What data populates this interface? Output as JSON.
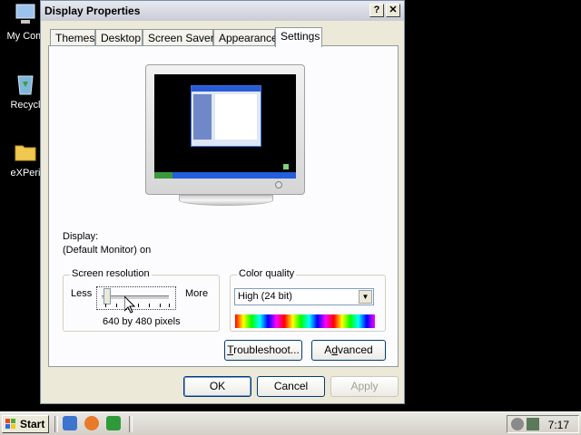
{
  "desktop": {
    "icons": [
      {
        "label": "My Com",
        "icon": "computer-icon"
      },
      {
        "label": "Recycl",
        "icon": "recycle-bin-icon"
      },
      {
        "label": "eXPeri",
        "icon": "folder-icon"
      }
    ]
  },
  "window": {
    "title": "Display Properties",
    "help_button": "?",
    "close_button": "✕",
    "tabs": [
      "Themes",
      "Desktop",
      "Screen Saver",
      "Appearance",
      "Settings"
    ],
    "active_tab": "Settings",
    "display_label": "Display:",
    "display_value": "(Default Monitor) on",
    "resolution": {
      "title": "Screen resolution",
      "less": "Less",
      "more": "More",
      "value_text": "640 by 480 pixels",
      "slider_level": 0
    },
    "color_quality": {
      "title": "Color quality",
      "selected": "High (24 bit)"
    },
    "buttons": {
      "troubleshoot": "Troubleshoot...",
      "advanced": "Advanced",
      "ok": "OK",
      "cancel": "Cancel",
      "apply": "Apply"
    }
  },
  "taskbar": {
    "start_label": "Start",
    "clock": "7:17"
  },
  "colors": {
    "window_bg": "#ece9d8",
    "panel_bg": "#fcfcfe",
    "desktop_bg": "#000000"
  }
}
